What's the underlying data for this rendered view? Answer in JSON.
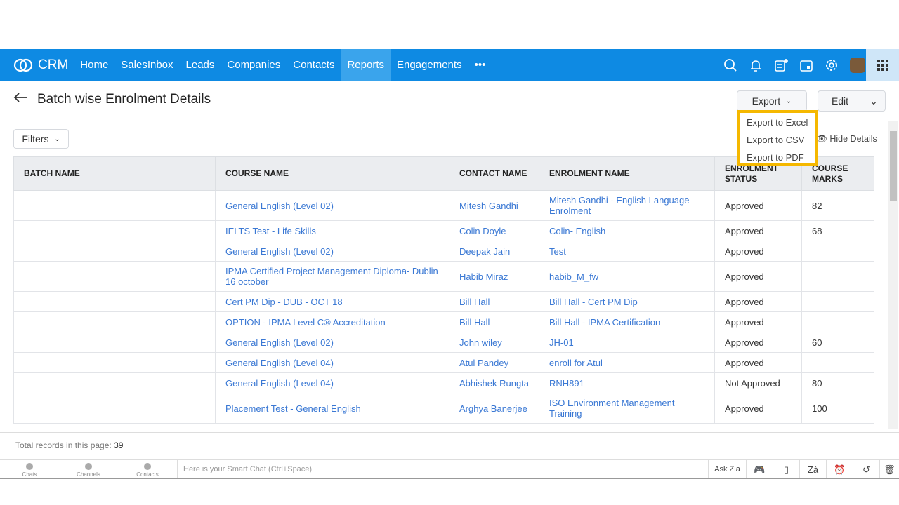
{
  "nav": {
    "brand": "CRM",
    "items": [
      "Home",
      "SalesInbox",
      "Leads",
      "Companies",
      "Contacts",
      "Reports",
      "Engagements"
    ],
    "active": "Reports",
    "more": "•••"
  },
  "page": {
    "title": "Batch wise Enrolment Details",
    "export_label": "Export",
    "edit_label": "Edit",
    "filters_label": "Filters",
    "hide_details": "Hide Details"
  },
  "export_menu": [
    "Export to Excel",
    "Export to CSV",
    "Export to PDF"
  ],
  "table": {
    "headers": [
      "BATCH NAME",
      "COURSE NAME",
      "CONTACT NAME",
      "ENROLMENT STATUS",
      "COURSE MARKS"
    ],
    "header_enrolment_name": "ENROLMENT NAME",
    "rows": [
      [
        "",
        "General English (Level 02)",
        "Mitesh Gandhi",
        "Mitesh Gandhi - English Language Enrolment",
        "Approved",
        "82"
      ],
      [
        "",
        "IELTS Test - Life Skills",
        "Colin Doyle",
        "Colin- English",
        "Approved",
        "68"
      ],
      [
        "",
        "General English (Level 02)",
        "Deepak Jain",
        "Test",
        "Approved",
        ""
      ],
      [
        "",
        "IPMA Certified Project Management Diploma- Dublin 16 october",
        "Habib Miraz",
        "habib_M_fw",
        "Approved",
        ""
      ],
      [
        "",
        "Cert PM Dip - DUB - OCT 18",
        "Bill Hall",
        "Bill Hall - Cert PM Dip",
        "Approved",
        ""
      ],
      [
        "",
        "OPTION - IPMA Level C® Accreditation",
        "Bill Hall",
        "Bill Hall - IPMA Certification",
        "Approved",
        ""
      ],
      [
        "",
        "General English (Level 02)",
        "John wiley",
        "JH-01",
        "Approved",
        "60"
      ],
      [
        "",
        "General English (Level 04)",
        "Atul Pandey",
        "enroll for Atul",
        "Approved",
        ""
      ],
      [
        "",
        "General English (Level 04)",
        "Abhishek Rungta",
        "RNH891",
        "Not Approved",
        "80"
      ],
      [
        "",
        "Placement Test - General English",
        "Arghya Banerjee",
        "ISO Environment Management Training",
        "Approved",
        "100"
      ]
    ]
  },
  "footer": {
    "label": "Total records in this page:",
    "count": "39"
  },
  "bottom": {
    "tabs": [
      "Chats",
      "Channels",
      "Contacts"
    ],
    "chat_placeholder": "Here is your Smart Chat (Ctrl+Space)",
    "ask_zia": "Ask Zia"
  },
  "colors": {
    "nav": "#0e8ae3",
    "highlight": "#f5b800",
    "link": "#3a78d4"
  }
}
